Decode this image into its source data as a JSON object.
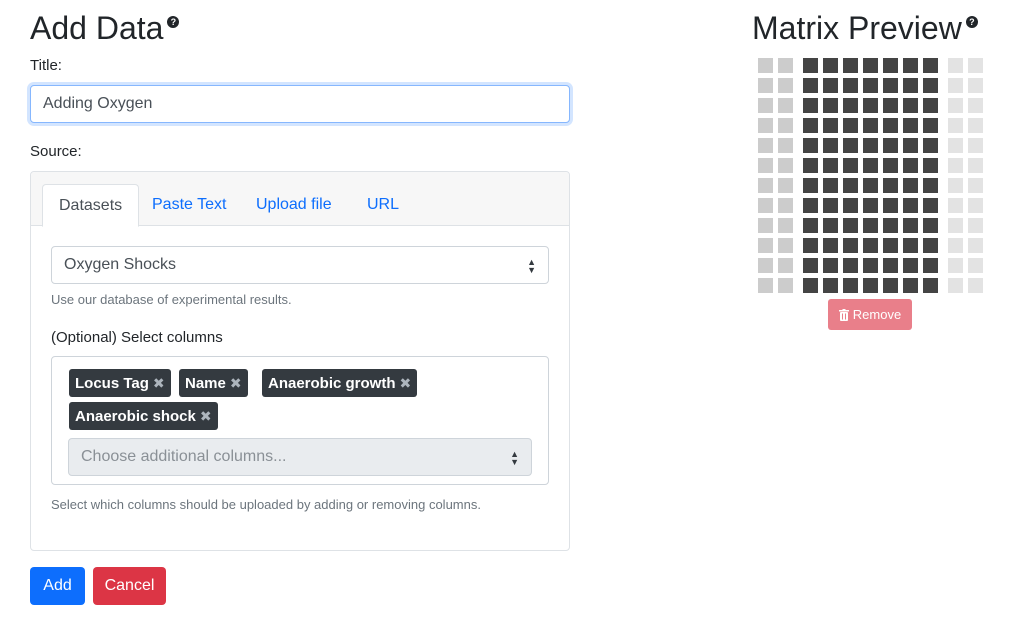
{
  "form": {
    "heading": "Add Data",
    "help_glyph": "?",
    "title_label": "Title:",
    "title_value": "Adding Oxygen",
    "source_label": "Source:"
  },
  "tabs": [
    {
      "label": "Datasets",
      "active": true
    },
    {
      "label": "Paste Text",
      "active": false
    },
    {
      "label": "Upload file",
      "active": false
    },
    {
      "label": "URL",
      "active": false
    }
  ],
  "dataset": {
    "selected": "Oxygen Shocks",
    "help": "Use our database of experimental results.",
    "columns_label": "(Optional) Select columns",
    "chips": [
      "Locus Tag",
      "Name",
      "Anaerobic growth",
      "Anaerobic shock"
    ],
    "chip_remove_glyph": "✖",
    "additional_placeholder": "Choose additional columns...",
    "columns_help": "Select which columns should be uploaded by adding or removing columns."
  },
  "actions": {
    "add_label": "Add",
    "cancel_label": "Cancel"
  },
  "preview": {
    "heading": "Matrix Preview",
    "help_glyph": "?",
    "remove_label": "Remove",
    "rows": 12,
    "column_groups": [
      "index",
      "index",
      "data",
      "data",
      "data",
      "data",
      "data",
      "data",
      "data",
      "extra",
      "extra"
    ],
    "colors": {
      "index": "#cccccc",
      "data": "#444444",
      "extra": "#e3e3e3"
    }
  },
  "colors": {
    "primary": "#0d6efd",
    "danger": "#dc3545",
    "chip": "#343a40"
  }
}
